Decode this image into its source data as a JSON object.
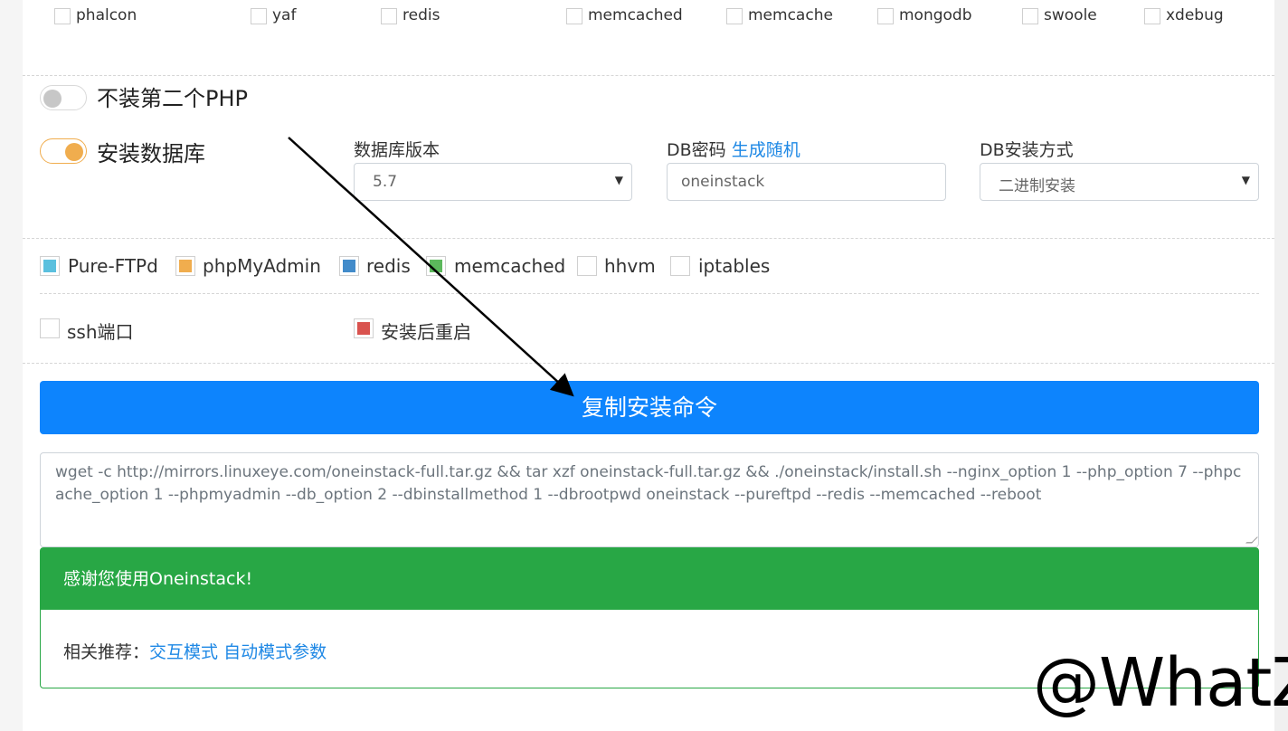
{
  "php_extensions": [
    {
      "label": "phalcon",
      "checked": false
    },
    {
      "label": "yaf",
      "checked": false
    },
    {
      "label": "redis",
      "checked": false
    },
    {
      "label": "memcached",
      "checked": false
    },
    {
      "label": "memcache",
      "checked": false
    },
    {
      "label": "mongodb",
      "checked": false
    },
    {
      "label": "swoole",
      "checked": false
    },
    {
      "label": "xdebug",
      "checked": false
    }
  ],
  "second_php_toggle": {
    "label": "不装第二个PHP",
    "on": false
  },
  "database_toggle": {
    "label": "安装数据库",
    "on": true
  },
  "db_version": {
    "label": "数据库版本",
    "value": "5.7"
  },
  "db_password": {
    "label": "DB密码",
    "generate_link": "生成随机",
    "value": "oneinstack"
  },
  "db_install_method": {
    "label": "DB安装方式",
    "value": "二进制安装"
  },
  "components": [
    {
      "label": "Pure-FTPd",
      "checked": true,
      "color": "#5bc0de"
    },
    {
      "label": "phpMyAdmin",
      "checked": true,
      "color": "#f0ad4e"
    },
    {
      "label": "redis",
      "checked": true,
      "color": "#428bca"
    },
    {
      "label": "memcached",
      "checked": true,
      "color": "#5cb85c"
    },
    {
      "label": "hhvm",
      "checked": false,
      "color": ""
    },
    {
      "label": "iptables",
      "checked": false,
      "color": ""
    }
  ],
  "ssh_port": {
    "label": "ssh端口",
    "checked": false
  },
  "reboot": {
    "label": "安装后重启",
    "checked": true,
    "color": "#d9534f"
  },
  "copy_button": {
    "label": "复制安装命令"
  },
  "command": "wget -c http://mirrors.linuxeye.com/oneinstack-full.tar.gz && tar xzf oneinstack-full.tar.gz && ./oneinstack/install.sh --nginx_option 1 --php_option 7 --phpcache_option 1 --phpmyadmin  --db_option 2 --dbinstallmethod 1 --dbrootpwd oneinstack --pureftpd  --redis  --memcached  --reboot",
  "thanks_card": {
    "title": "感谢您使用Oneinstack!",
    "related_prefix": "相关推荐：",
    "link_interactive": "交互模式",
    "link_auto": "自动模式参数"
  },
  "watermark": "@WhatZ",
  "colors": {
    "primary": "#0d84fd",
    "success": "#28a745",
    "link": "#1e88e5",
    "toggle_on": "#f0ad4e"
  }
}
